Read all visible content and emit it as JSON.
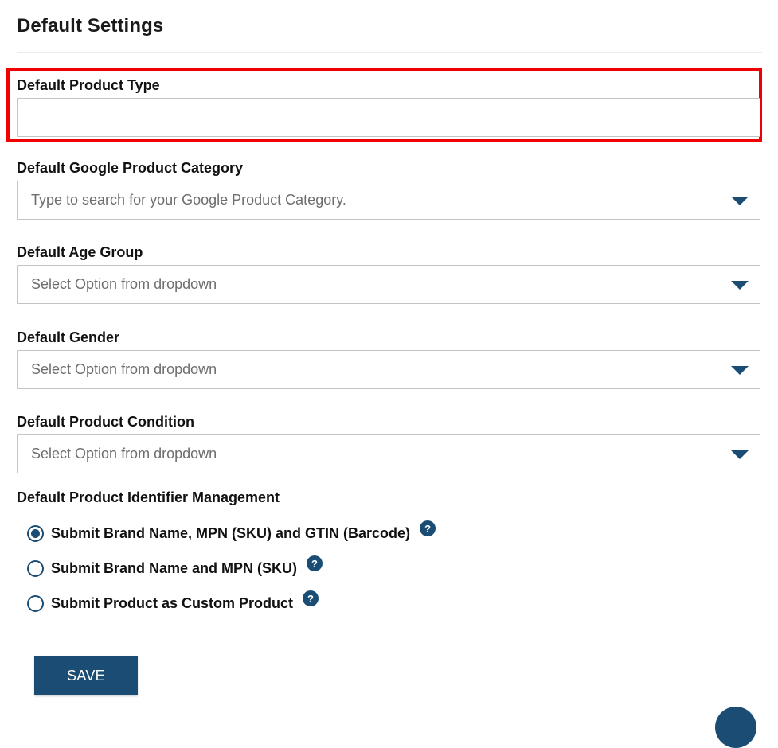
{
  "page": {
    "title": "Default Settings"
  },
  "fields": {
    "product_type": {
      "label": "Default Product Type",
      "value": "",
      "placeholder": ""
    },
    "google_category": {
      "label": "Default Google Product Category",
      "placeholder": "Type to search for your Google Product Category."
    },
    "age_group": {
      "label": "Default Age Group",
      "placeholder": "Select Option from dropdown"
    },
    "gender": {
      "label": "Default Gender",
      "placeholder": "Select Option from dropdown"
    },
    "condition": {
      "label": "Default Product Condition",
      "placeholder": "Select Option from dropdown"
    }
  },
  "identifier": {
    "label": "Default Product Identifier Management",
    "options": [
      {
        "label": "Submit Brand Name, MPN (SKU) and GTIN (Barcode)",
        "checked": true
      },
      {
        "label": "Submit Brand Name and MPN (SKU)",
        "checked": false
      },
      {
        "label": "Submit Product as Custom Product",
        "checked": false
      }
    ],
    "help_glyph": "?"
  },
  "actions": {
    "save_label": "SAVE"
  },
  "icons": {
    "dropdown": "chevron-down-icon",
    "help": "help-icon"
  },
  "colors": {
    "primary": "#1b4d74",
    "highlight": "#f00000"
  }
}
